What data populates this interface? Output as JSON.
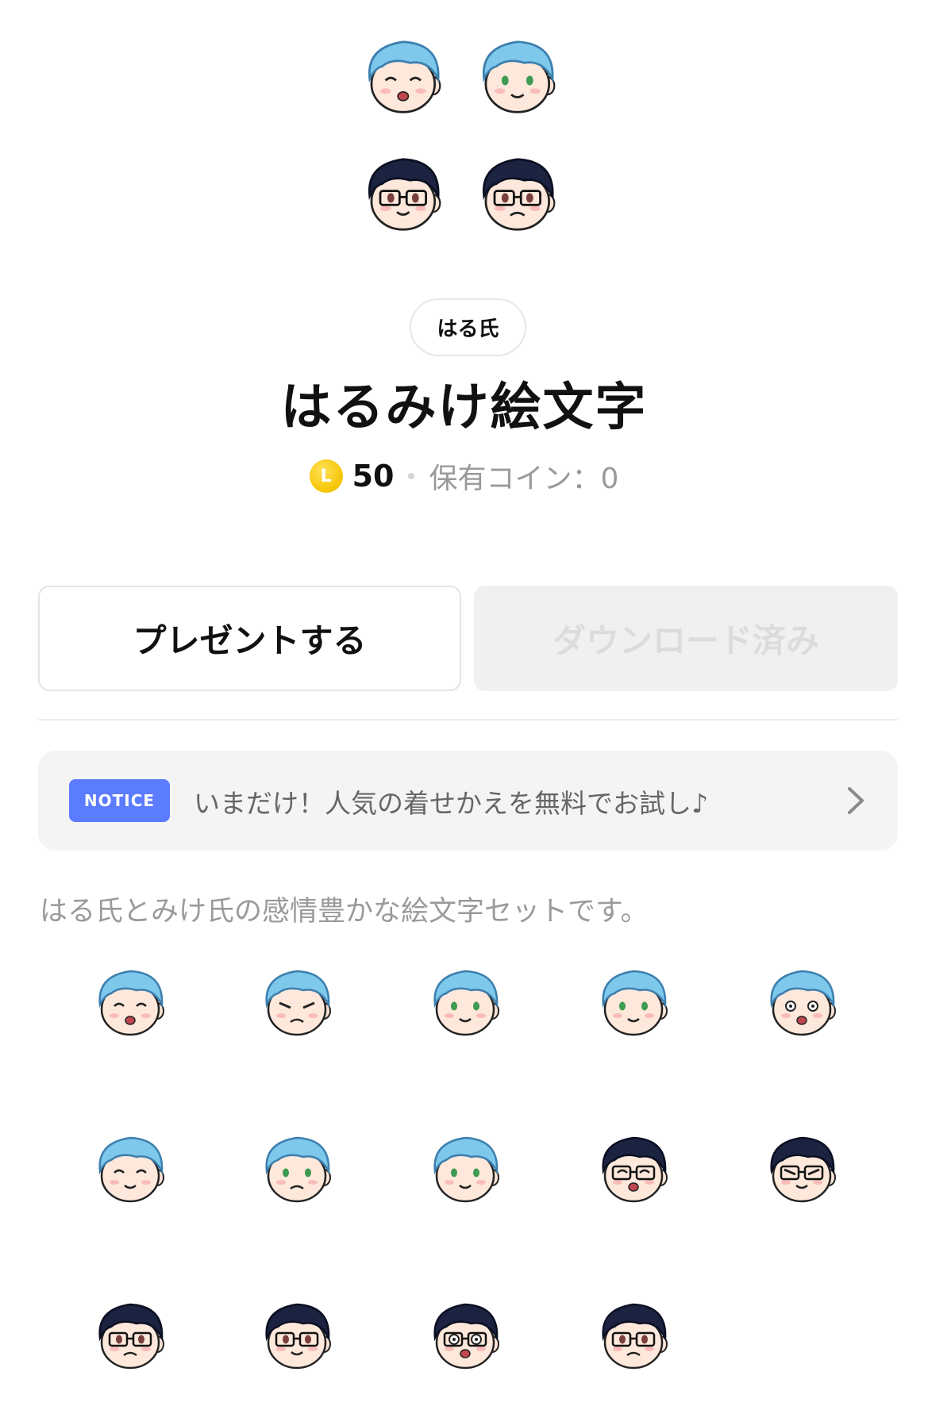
{
  "author": {
    "name": "はる氏"
  },
  "title": "はるみけ絵文字",
  "price": {
    "coin_label": "L",
    "amount": "50",
    "held_coins": "保有コイン：0"
  },
  "actions": {
    "present_label": "プレゼントする",
    "download_label": "ダウンロード済み"
  },
  "notice": {
    "badge": "NOTICE",
    "text": "いまだけ！人気の着せかえを無料でお試し♪"
  },
  "description": "はる氏とみけ氏の感情豊かな絵文字セットです。",
  "colors": {
    "accent_blue": "#5b7cff",
    "coin_gold": "#f5c400",
    "hair_blue": "#7ec8ec",
    "hair_dark": "#1c2340"
  },
  "hero_emoji": [
    {
      "icon": "blue-hair-laughing-icon"
    },
    {
      "icon": "blue-hair-smiling-icon"
    },
    {
      "icon": "dark-hair-glasses-smiling-icon"
    },
    {
      "icon": "dark-hair-glasses-worried-icon"
    }
  ],
  "emoji_grid": [
    {
      "icon": "blue-hair-laughing-icon"
    },
    {
      "icon": "blue-hair-angry-icon"
    },
    {
      "icon": "blue-hair-sweating-icon"
    },
    {
      "icon": "blue-hair-smiling-icon"
    },
    {
      "icon": "blue-hair-shocked-icon"
    },
    {
      "icon": "blue-hair-happy-icon"
    },
    {
      "icon": "blue-hair-crying-icon"
    },
    {
      "icon": "blue-hair-calm-icon"
    },
    {
      "icon": "dark-hair-glasses-laughing-icon"
    },
    {
      "icon": "dark-hair-glasses-annoyed-icon"
    },
    {
      "icon": "dark-hair-glasses-frown-icon"
    },
    {
      "icon": "dark-hair-glasses-smirk-icon"
    },
    {
      "icon": "dark-hair-glasses-surprised-icon"
    },
    {
      "icon": "dark-hair-glasses-worried-icon"
    }
  ]
}
